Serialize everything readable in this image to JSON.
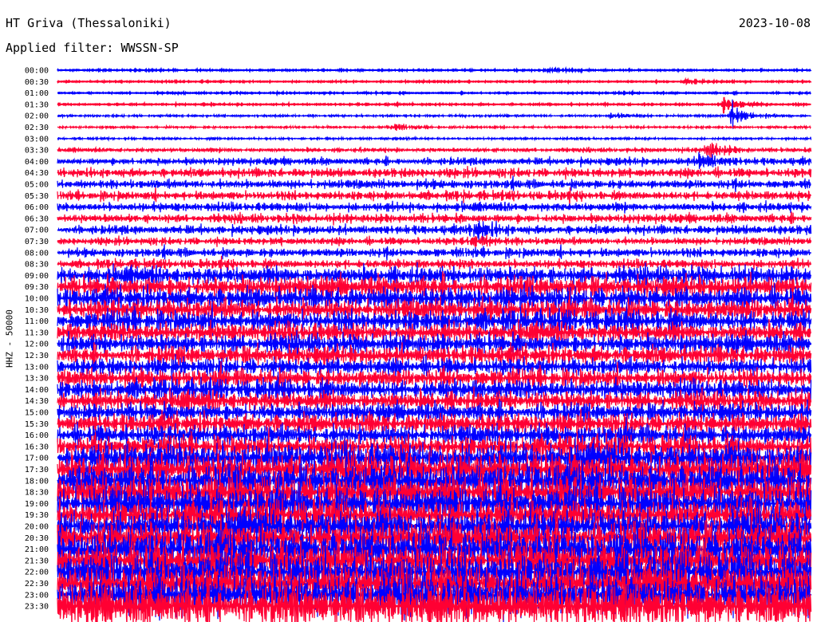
{
  "header": {
    "station": "HT Griva (Thessaloniki)",
    "date": "2023-10-08",
    "filter": "Applied filter: WWSSN-SP"
  },
  "chart_data": {
    "type": "line",
    "title": "HT Griva (Thessaloniki)",
    "ylabel": "HHZ - 50000",
    "xlabel": "",
    "minutes_per_line": 30,
    "series_colors": [
      "#0000ff",
      "#ff0033"
    ],
    "row_labels": [
      "00:00",
      "00:30",
      "01:00",
      "01:30",
      "02:00",
      "02:30",
      "03:00",
      "03:30",
      "04:00",
      "04:30",
      "05:00",
      "05:30",
      "06:00",
      "06:30",
      "07:00",
      "07:30",
      "08:00",
      "08:30",
      "09:00",
      "09:30",
      "10:00",
      "10:30",
      "11:00",
      "11:30",
      "12:00",
      "12:30",
      "13:00",
      "13:30",
      "14:00",
      "14:30",
      "15:00",
      "15:30",
      "16:00",
      "16:30",
      "17:00",
      "17:30",
      "18:00",
      "18:30",
      "19:00",
      "19:30",
      "20:00",
      "20:30",
      "21:00",
      "21:30",
      "22:00",
      "22:30",
      "23:00",
      "23:30"
    ],
    "relative_amplitude": [
      1,
      1,
      1,
      1,
      2,
      2,
      2,
      3,
      5,
      6,
      6,
      6,
      6,
      6,
      6,
      5,
      6,
      6,
      12,
      14,
      14,
      14,
      14,
      13,
      13,
      12,
      11,
      12,
      13,
      13,
      12,
      13,
      13,
      14,
      20,
      22,
      22,
      22,
      22,
      20,
      22,
      22,
      24,
      24,
      25,
      26,
      26,
      28
    ],
    "events": [
      {
        "row": 0,
        "minute": 19.5,
        "amplitude": 3
      },
      {
        "row": 1,
        "minute": 25.0,
        "amplitude": 3
      },
      {
        "row": 3,
        "minute": 26.5,
        "amplitude": 12
      },
      {
        "row": 4,
        "minute": 26.8,
        "amplitude": 22
      },
      {
        "row": 4,
        "minute": 22.0,
        "amplitude": 6
      },
      {
        "row": 5,
        "minute": 13.2,
        "amplitude": 8
      },
      {
        "row": 7,
        "minute": 25.8,
        "amplitude": 20
      },
      {
        "row": 8,
        "minute": 25.5,
        "amplitude": 18
      },
      {
        "row": 14,
        "minute": 16.5,
        "amplitude": 18
      },
      {
        "row": 15,
        "minute": 16.5,
        "amplitude": 12
      }
    ]
  }
}
